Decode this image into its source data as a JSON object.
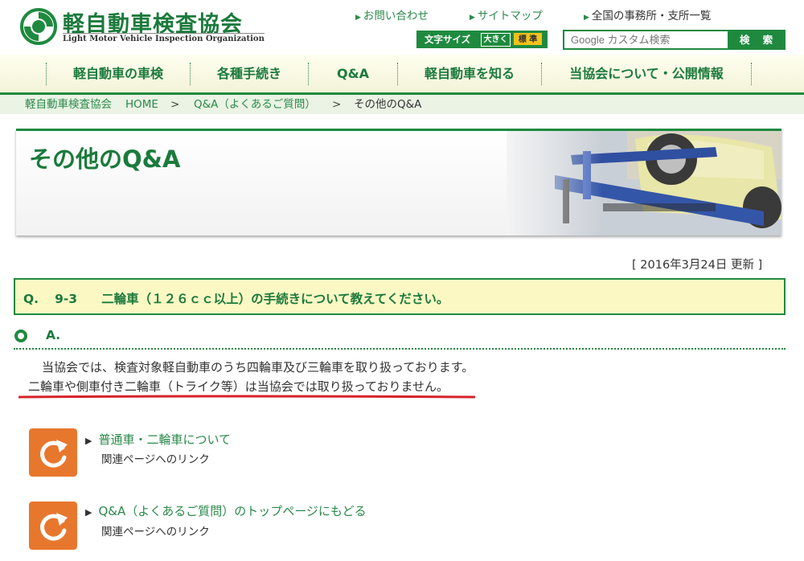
{
  "site": {
    "name_jp": "軽自動車検査協会",
    "name_en": "Light Motor Vehicle Inspection Organization"
  },
  "top_links": [
    "お問い合わせ",
    "サイトマップ",
    "全国の事務所・支所一覧"
  ],
  "font_size": {
    "label": "文字サイズ",
    "large": "大きく",
    "standard": "標 準"
  },
  "search": {
    "placeholder": "Google カスタム検索",
    "button": "検 索"
  },
  "nav": [
    "軽自動車の車検",
    "各種手続き",
    "Q&A",
    "軽自動車を知る",
    "当協会について・公開情報"
  ],
  "breadcrumb": {
    "items": [
      "軽自動車検査協会",
      "HOME",
      "Q&A（よくあるご質問）"
    ],
    "separator": ">",
    "current": "その他のQ&A"
  },
  "page": {
    "title": "その他のQ&A",
    "updated": "[ 2016年3月24日 更新 ]"
  },
  "question": {
    "prefix": "Q.",
    "number": "9-3",
    "text": "二輪車（１２６ｃｃ以上）の手続きについて教えてください。"
  },
  "answer": {
    "label": "A.",
    "line1": "当協会では、検査対象軽自動車のうち四輪車及び三輪車を取り扱っております。",
    "line2": "二輪車や側車付き二輪車（トライク等）は当協会では取り扱っておりません。"
  },
  "related_links": [
    {
      "title": "普通車・二輪車について",
      "desc": "関連ページへのリンク"
    },
    {
      "title": "Q&A（よくあるご質問）のトップページにもどる",
      "desc": "関連ページへのリンク"
    }
  ],
  "colors": {
    "brand_green": "#1f8a3f",
    "accent_orange": "#e8772e",
    "underline_red": "#d6232b",
    "question_bg": "#fbf8c4"
  },
  "icons": [
    "logo-ring-icon",
    "triangle-right-icon",
    "radio-circle-icon",
    "refresh-arrow-icon"
  ]
}
